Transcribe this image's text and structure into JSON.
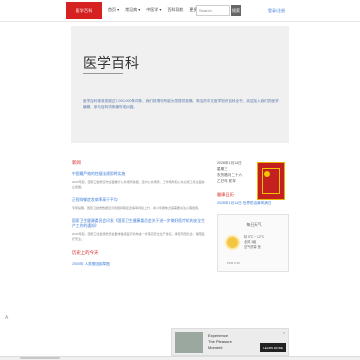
{
  "header": {
    "logo_text": "医学百科",
    "nav": [
      "首页 ▾",
      "常见病 ▾",
      "中医学 ▾",
      "百科导航",
      "更多 ▾"
    ],
    "search_placeholder": "Search",
    "search_button": "搜索",
    "login": "登录/注册"
  },
  "hero": {
    "title": "医学百科",
    "description": "医学百科现收录超过7,000,000条词条，我们将竭尽所能为您提供准确、简洁的中文医学知识百科全书，欢迎加入我们的医学编辑、参与百科词条编写或纠错。"
  },
  "news": {
    "section_title": "新闻",
    "items": [
      {
        "title": "中国最严格的控烟法规即将实施",
        "body": "2026年起，国家卫健委宣布全面推行公共场所禁烟，室内公共场所、工作场所和公共交通工具全面禁止吸烟。"
      },
      {
        "title": "正视抑郁症发病率高于平均",
        "body": "专家提醒，国家卫健委数据显示我国抑郁症患病率持续上升，青少年群体尤其需要关注心理健康。"
      },
      {
        "title": "国家卫生健康委员会印发《国家卫生健康委员会关于进一步做好医疗机构安全生产工作的通知》",
        "body": "2026年起，国家卫生健康委员会要求各级医疗机构进一步落实安全生产责任，排查风险隐患，保障医疗安全。"
      }
    ],
    "history_title": "历史上的今天",
    "history_item": "2000年 人类基因组草图"
  },
  "side": {
    "date_lines": [
      "2026年1月14日",
      "星期三",
      "农历腊月二十六",
      "乙巳年 蛇年"
    ],
    "section_title": "健康日历",
    "link": "2026年1月14日 世界防治麻风病日",
    "weather_title": "每日天气",
    "weather_lines": [
      "晴 5°C ~ 12°C",
      "北风 3级",
      "空气质量 良"
    ],
    "weather_foot": "PM2.5 45"
  },
  "ad": {
    "line1": "Experience",
    "line2": "The Pleasure",
    "line3": "Moment",
    "button": "LEARN MORE",
    "close": "×"
  },
  "corner_mark": "A"
}
